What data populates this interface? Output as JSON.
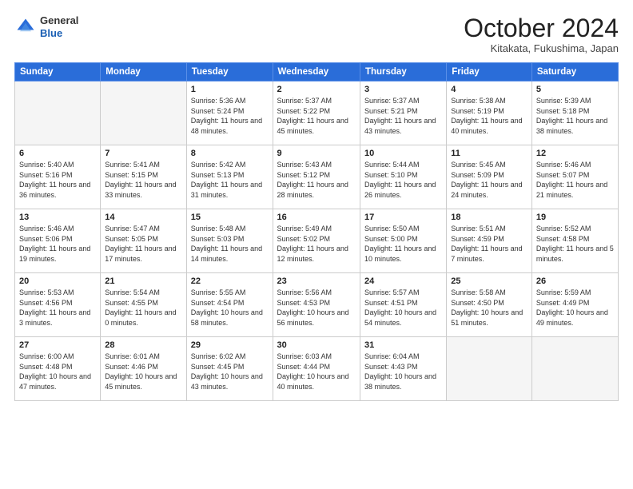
{
  "logo": {
    "general": "General",
    "blue": "Blue"
  },
  "header": {
    "month": "October 2024",
    "location": "Kitakata, Fukushima, Japan"
  },
  "weekdays": [
    "Sunday",
    "Monday",
    "Tuesday",
    "Wednesday",
    "Thursday",
    "Friday",
    "Saturday"
  ],
  "weeks": [
    [
      {
        "day": "",
        "sunrise": "",
        "sunset": "",
        "daylight": ""
      },
      {
        "day": "",
        "sunrise": "",
        "sunset": "",
        "daylight": ""
      },
      {
        "day": "1",
        "sunrise": "Sunrise: 5:36 AM",
        "sunset": "Sunset: 5:24 PM",
        "daylight": "Daylight: 11 hours and 48 minutes."
      },
      {
        "day": "2",
        "sunrise": "Sunrise: 5:37 AM",
        "sunset": "Sunset: 5:22 PM",
        "daylight": "Daylight: 11 hours and 45 minutes."
      },
      {
        "day": "3",
        "sunrise": "Sunrise: 5:37 AM",
        "sunset": "Sunset: 5:21 PM",
        "daylight": "Daylight: 11 hours and 43 minutes."
      },
      {
        "day": "4",
        "sunrise": "Sunrise: 5:38 AM",
        "sunset": "Sunset: 5:19 PM",
        "daylight": "Daylight: 11 hours and 40 minutes."
      },
      {
        "day": "5",
        "sunrise": "Sunrise: 5:39 AM",
        "sunset": "Sunset: 5:18 PM",
        "daylight": "Daylight: 11 hours and 38 minutes."
      }
    ],
    [
      {
        "day": "6",
        "sunrise": "Sunrise: 5:40 AM",
        "sunset": "Sunset: 5:16 PM",
        "daylight": "Daylight: 11 hours and 36 minutes."
      },
      {
        "day": "7",
        "sunrise": "Sunrise: 5:41 AM",
        "sunset": "Sunset: 5:15 PM",
        "daylight": "Daylight: 11 hours and 33 minutes."
      },
      {
        "day": "8",
        "sunrise": "Sunrise: 5:42 AM",
        "sunset": "Sunset: 5:13 PM",
        "daylight": "Daylight: 11 hours and 31 minutes."
      },
      {
        "day": "9",
        "sunrise": "Sunrise: 5:43 AM",
        "sunset": "Sunset: 5:12 PM",
        "daylight": "Daylight: 11 hours and 28 minutes."
      },
      {
        "day": "10",
        "sunrise": "Sunrise: 5:44 AM",
        "sunset": "Sunset: 5:10 PM",
        "daylight": "Daylight: 11 hours and 26 minutes."
      },
      {
        "day": "11",
        "sunrise": "Sunrise: 5:45 AM",
        "sunset": "Sunset: 5:09 PM",
        "daylight": "Daylight: 11 hours and 24 minutes."
      },
      {
        "day": "12",
        "sunrise": "Sunrise: 5:46 AM",
        "sunset": "Sunset: 5:07 PM",
        "daylight": "Daylight: 11 hours and 21 minutes."
      }
    ],
    [
      {
        "day": "13",
        "sunrise": "Sunrise: 5:46 AM",
        "sunset": "Sunset: 5:06 PM",
        "daylight": "Daylight: 11 hours and 19 minutes."
      },
      {
        "day": "14",
        "sunrise": "Sunrise: 5:47 AM",
        "sunset": "Sunset: 5:05 PM",
        "daylight": "Daylight: 11 hours and 17 minutes."
      },
      {
        "day": "15",
        "sunrise": "Sunrise: 5:48 AM",
        "sunset": "Sunset: 5:03 PM",
        "daylight": "Daylight: 11 hours and 14 minutes."
      },
      {
        "day": "16",
        "sunrise": "Sunrise: 5:49 AM",
        "sunset": "Sunset: 5:02 PM",
        "daylight": "Daylight: 11 hours and 12 minutes."
      },
      {
        "day": "17",
        "sunrise": "Sunrise: 5:50 AM",
        "sunset": "Sunset: 5:00 PM",
        "daylight": "Daylight: 11 hours and 10 minutes."
      },
      {
        "day": "18",
        "sunrise": "Sunrise: 5:51 AM",
        "sunset": "Sunset: 4:59 PM",
        "daylight": "Daylight: 11 hours and 7 minutes."
      },
      {
        "day": "19",
        "sunrise": "Sunrise: 5:52 AM",
        "sunset": "Sunset: 4:58 PM",
        "daylight": "Daylight: 11 hours and 5 minutes."
      }
    ],
    [
      {
        "day": "20",
        "sunrise": "Sunrise: 5:53 AM",
        "sunset": "Sunset: 4:56 PM",
        "daylight": "Daylight: 11 hours and 3 minutes."
      },
      {
        "day": "21",
        "sunrise": "Sunrise: 5:54 AM",
        "sunset": "Sunset: 4:55 PM",
        "daylight": "Daylight: 11 hours and 0 minutes."
      },
      {
        "day": "22",
        "sunrise": "Sunrise: 5:55 AM",
        "sunset": "Sunset: 4:54 PM",
        "daylight": "Daylight: 10 hours and 58 minutes."
      },
      {
        "day": "23",
        "sunrise": "Sunrise: 5:56 AM",
        "sunset": "Sunset: 4:53 PM",
        "daylight": "Daylight: 10 hours and 56 minutes."
      },
      {
        "day": "24",
        "sunrise": "Sunrise: 5:57 AM",
        "sunset": "Sunset: 4:51 PM",
        "daylight": "Daylight: 10 hours and 54 minutes."
      },
      {
        "day": "25",
        "sunrise": "Sunrise: 5:58 AM",
        "sunset": "Sunset: 4:50 PM",
        "daylight": "Daylight: 10 hours and 51 minutes."
      },
      {
        "day": "26",
        "sunrise": "Sunrise: 5:59 AM",
        "sunset": "Sunset: 4:49 PM",
        "daylight": "Daylight: 10 hours and 49 minutes."
      }
    ],
    [
      {
        "day": "27",
        "sunrise": "Sunrise: 6:00 AM",
        "sunset": "Sunset: 4:48 PM",
        "daylight": "Daylight: 10 hours and 47 minutes."
      },
      {
        "day": "28",
        "sunrise": "Sunrise: 6:01 AM",
        "sunset": "Sunset: 4:46 PM",
        "daylight": "Daylight: 10 hours and 45 minutes."
      },
      {
        "day": "29",
        "sunrise": "Sunrise: 6:02 AM",
        "sunset": "Sunset: 4:45 PM",
        "daylight": "Daylight: 10 hours and 43 minutes."
      },
      {
        "day": "30",
        "sunrise": "Sunrise: 6:03 AM",
        "sunset": "Sunset: 4:44 PM",
        "daylight": "Daylight: 10 hours and 40 minutes."
      },
      {
        "day": "31",
        "sunrise": "Sunrise: 6:04 AM",
        "sunset": "Sunset: 4:43 PM",
        "daylight": "Daylight: 10 hours and 38 minutes."
      },
      {
        "day": "",
        "sunrise": "",
        "sunset": "",
        "daylight": ""
      },
      {
        "day": "",
        "sunrise": "",
        "sunset": "",
        "daylight": ""
      }
    ]
  ]
}
